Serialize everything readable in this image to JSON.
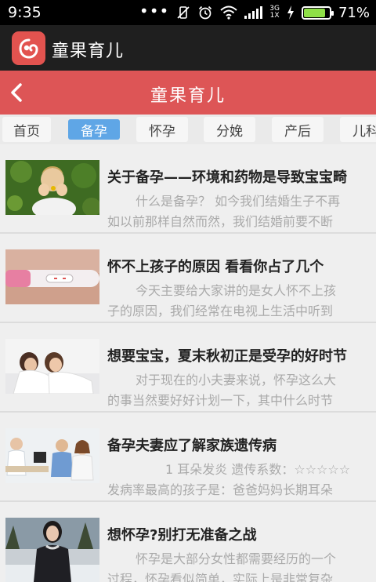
{
  "status": {
    "time": "9:35",
    "battery_level": 0.85,
    "battery_pct": "71%",
    "network": [
      "3G",
      "1X"
    ],
    "icons": [
      "more-dots-icon",
      "vibrate-off-icon",
      "alarm-icon",
      "wifi-icon",
      "signal-icon",
      "charging-icon",
      "battery-icon"
    ]
  },
  "app": {
    "name": "童果育儿"
  },
  "header": {
    "title": "童果育儿"
  },
  "tabs": [
    "首页",
    "备孕",
    "怀孕",
    "分娩",
    "产后",
    "儿科"
  ],
  "active_tab": "备孕",
  "colors": {
    "header": "#dd5556",
    "tab_active": "#5fa6e6",
    "appbar": "#1f1f1f"
  },
  "articles": [
    {
      "title": "关于备孕——环境和药物是导致宝宝畸",
      "summary_line1": "什么是备孕？ 如今我们结婚生子不再",
      "summary_line2": "如以前那样自然而然，我们结婚前要不断"
    },
    {
      "title": "怀不上孩子的原因 看看你占了几个",
      "summary_line1": "今天主要给大家讲的是女人怀不上孩",
      "summary_line2": "子的原因，我们经常在电视上生活中听到"
    },
    {
      "title": "想要宝宝，夏末秋初正是受孕的好时节",
      "summary_line1": "对于现在的小夫妻来说，怀孕这么大",
      "summary_line2": "的事当然要好好计划一下，其中什么时节"
    },
    {
      "title": "备孕夫妻应了解家族遗传病",
      "summary_line1": "1 耳朵发炎 遗传系数：☆☆☆☆☆",
      "summary_line2": "发病率最高的孩子是：爸爸妈妈长期耳朵"
    },
    {
      "title": "想怀孕?别打无准备之战",
      "summary_line1": "怀孕是大部分女性都需要经历的一个",
      "summary_line2": "过程，怀孕看似简单，实际上是非常复杂"
    }
  ]
}
